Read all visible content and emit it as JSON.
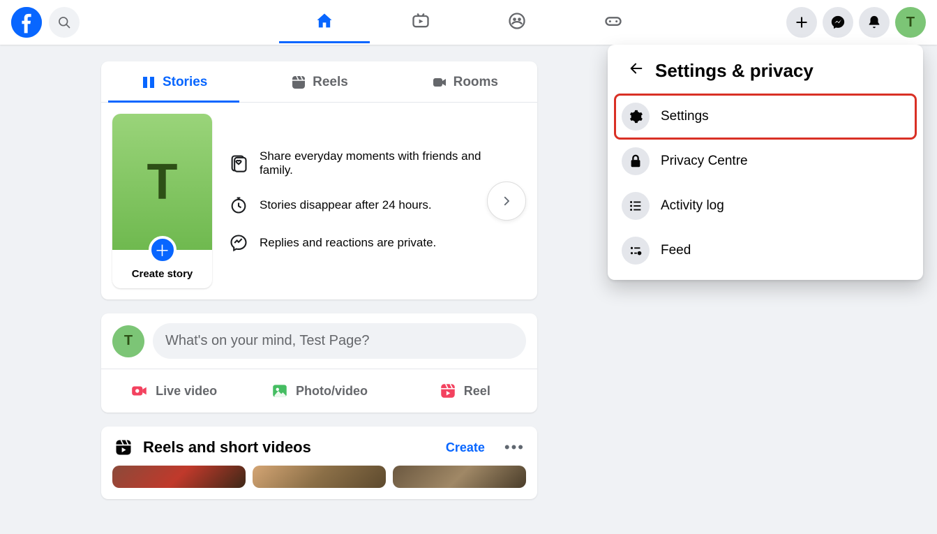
{
  "user": {
    "initial": "T"
  },
  "nav": {
    "tabs": [
      "home",
      "video",
      "groups",
      "gaming"
    ]
  },
  "contentTabs": {
    "stories": "Stories",
    "reels": "Reels",
    "rooms": "Rooms"
  },
  "story": {
    "createLabel": "Create story",
    "info1": "Share everyday moments with friends and family.",
    "info2": "Stories disappear after 24 hours.",
    "info3": "Replies and reactions are private."
  },
  "composer": {
    "placeholder": "What's on your mind, Test Page?",
    "live": "Live video",
    "photo": "Photo/video",
    "reel": "Reel"
  },
  "reels": {
    "title": "Reels and short videos",
    "create": "Create"
  },
  "dropdown": {
    "title": "Settings & privacy",
    "settings": "Settings",
    "privacy": "Privacy Centre",
    "activity": "Activity log",
    "feed": "Feed"
  }
}
